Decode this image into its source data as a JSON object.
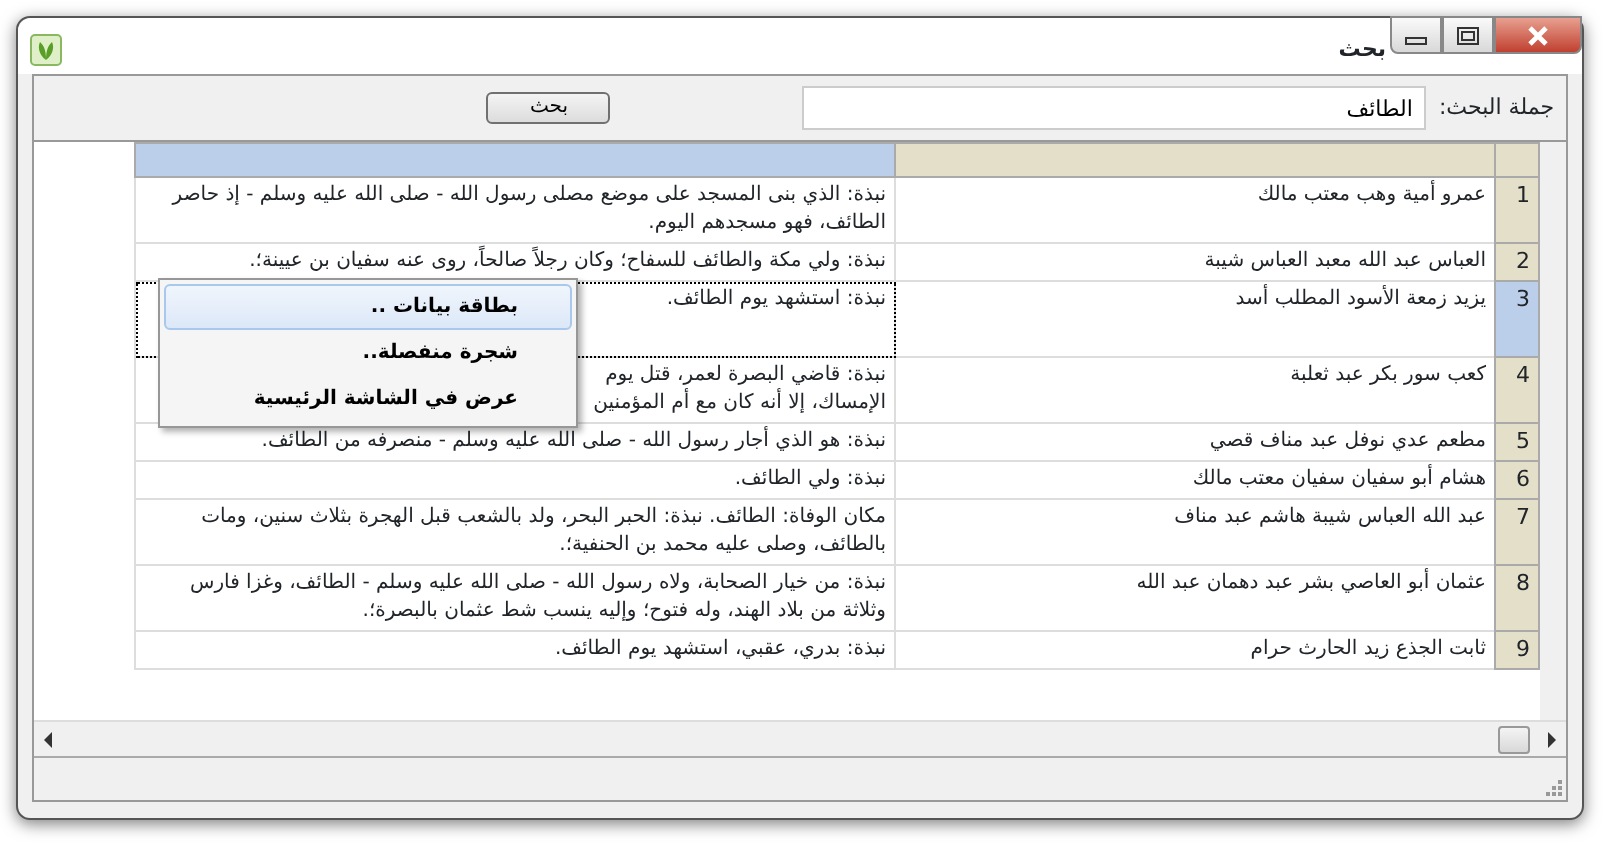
{
  "window": {
    "title": "بحث"
  },
  "search": {
    "label": "جملة البحث:",
    "value": "الطائف",
    "button": "بحث"
  },
  "table": {
    "columns": [
      {
        "selected": false
      },
      {
        "selected": true
      }
    ],
    "rows": [
      {
        "number": "1",
        "name": "عمرو أمية وهب معتب مالك",
        "details": "نبذة: الذي بنى المسجد على موضع مصلى رسول الله - صلى الله عليه وسلم - إذ حاصر الطائف، فهو مسجدهم اليوم.",
        "selected": false,
        "focused": false
      },
      {
        "number": "2",
        "name": "العباس عبد الله معبد العباس شيبة",
        "details": "نبذة: ولي مكة والطائف للسفاح؛ وكان رجلاً صالحاً، روى عنه سفيان بن عيينة؛.",
        "selected": false,
        "focused": false
      },
      {
        "number": "3",
        "name": "يزيد زمعة الأسود المطلب أسد",
        "details": "نبذة: استشهد يوم الطائف.",
        "selected": true,
        "focused": true
      },
      {
        "number": "4",
        "name": "كعب سور بكر عبد ثعلبة",
        "details": "نبذة: قاضي البصرة لعمر، قتل يوم\nالإمساك، إلا أنه كان مع أم المؤمنين",
        "selected": false,
        "focused": false
      },
      {
        "number": "5",
        "name": "مطعم عدي نوفل عبد مناف قصي",
        "details": "نبذة: هو الذي أجار رسول الله - صلى الله عليه وسلم - منصرفه من الطائف.",
        "selected": false,
        "focused": false
      },
      {
        "number": "6",
        "name": "هشام أبو سفيان سفيان معتب مالك",
        "details": "نبذة: ولي الطائف.",
        "selected": false,
        "focused": false
      },
      {
        "number": "7",
        "name": "عبد الله العباس شيبة هاشم عبد مناف",
        "details": "مكان الوفاة: الطائف. نبذة: الحبر البحر، ولد بالشعب قبل الهجرة بثلاث سنين، ومات بالطائف، وصلى عليه محمد بن الحنفية؛.",
        "selected": false,
        "focused": false
      },
      {
        "number": "8",
        "name": "عثمان أبو العاصي بشر عبد دهمان عبد الله",
        "details": "نبذة: من خيار الصحابة، ولاه رسول الله - صلى الله عليه وسلم - الطائف، وغزا فارس وثلاثة من بلاد الهند، وله فتوح؛ وإليه ينسب شط عثمان بالبصرة؛.",
        "selected": false,
        "focused": false
      },
      {
        "number": "9",
        "name": "ثابت الجذع زيد الحارث حرام",
        "details": "نبذة: بدري، عقبي، استشهد يوم الطائف.",
        "selected": false,
        "focused": false
      }
    ]
  },
  "context_menu": [
    {
      "label": "بطاقة بيانات ..",
      "selected": true
    },
    {
      "label": "شجرة منفصلة..",
      "selected": false
    },
    {
      "label": "عرض في الشاشة الرئيسية",
      "selected": false
    }
  ]
}
